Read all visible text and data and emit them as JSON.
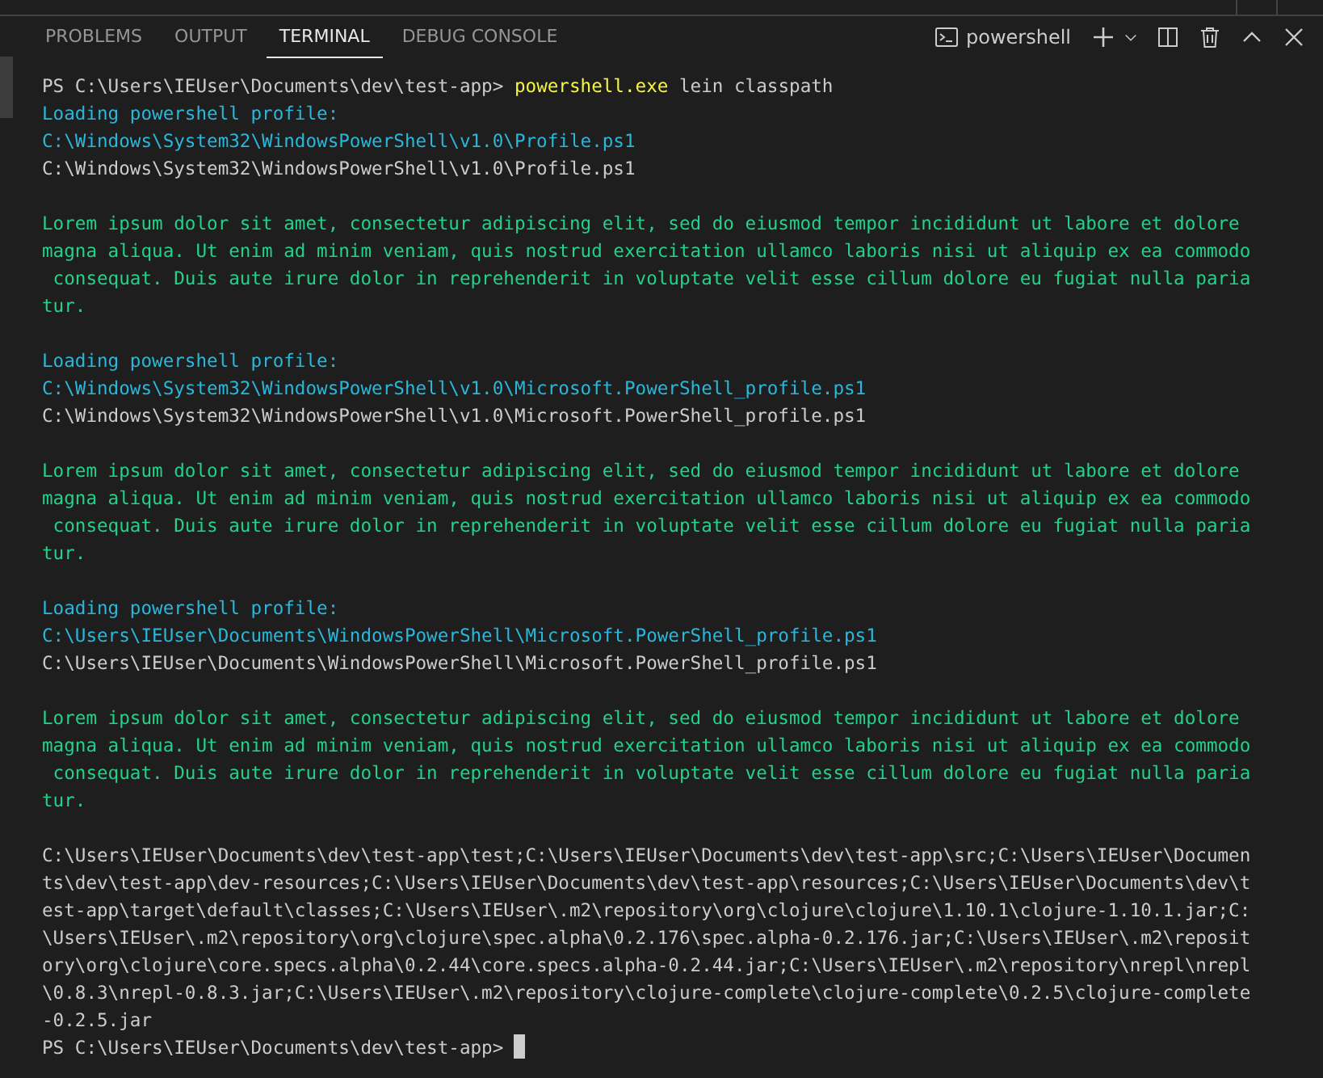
{
  "panel_tabs": [
    {
      "label": "PROBLEMS",
      "selected": false
    },
    {
      "label": "OUTPUT",
      "selected": false
    },
    {
      "label": "TERMINAL",
      "selected": true
    },
    {
      "label": "DEBUG CONSOLE",
      "selected": false
    }
  ],
  "terminal_selector": {
    "label": "powershell"
  },
  "terminal": {
    "lines": [
      {
        "kind": "prompt",
        "prompt": "PS C:\\Users\\IEUser\\Documents\\dev\\test-app>",
        "command": "powershell.exe",
        "args": "lein classpath"
      },
      {
        "kind": "info",
        "text": "Loading powershell profile:"
      },
      {
        "kind": "info",
        "text": "C:\\Windows\\System32\\WindowsPowerShell\\v1.0\\Profile.ps1"
      },
      {
        "kind": "plain",
        "text": "C:\\Windows\\System32\\WindowsPowerShell\\v1.0\\Profile.ps1"
      },
      {
        "kind": "blank"
      },
      {
        "kind": "success",
        "text": "Lorem ipsum dolor sit amet, consectetur adipiscing elit, sed do eiusmod tempor incididunt ut labore et dolore"
      },
      {
        "kind": "success",
        "text": "magna aliqua. Ut enim ad minim veniam, quis nostrud exercitation ullamco laboris nisi ut aliquip ex ea commodo"
      },
      {
        "kind": "success",
        "text": " consequat. Duis aute irure dolor in reprehenderit in voluptate velit esse cillum dolore eu fugiat nulla paria"
      },
      {
        "kind": "success",
        "text": "tur."
      },
      {
        "kind": "blank"
      },
      {
        "kind": "info",
        "text": "Loading powershell profile:"
      },
      {
        "kind": "info",
        "text": "C:\\Windows\\System32\\WindowsPowerShell\\v1.0\\Microsoft.PowerShell_profile.ps1"
      },
      {
        "kind": "plain",
        "text": "C:\\Windows\\System32\\WindowsPowerShell\\v1.0\\Microsoft.PowerShell_profile.ps1"
      },
      {
        "kind": "blank"
      },
      {
        "kind": "success",
        "text": "Lorem ipsum dolor sit amet, consectetur adipiscing elit, sed do eiusmod tempor incididunt ut labore et dolore"
      },
      {
        "kind": "success",
        "text": "magna aliqua. Ut enim ad minim veniam, quis nostrud exercitation ullamco laboris nisi ut aliquip ex ea commodo"
      },
      {
        "kind": "success",
        "text": " consequat. Duis aute irure dolor in reprehenderit in voluptate velit esse cillum dolore eu fugiat nulla paria"
      },
      {
        "kind": "success",
        "text": "tur."
      },
      {
        "kind": "blank"
      },
      {
        "kind": "info",
        "text": "Loading powershell profile:"
      },
      {
        "kind": "info",
        "text": "C:\\Users\\IEUser\\Documents\\WindowsPowerShell\\Microsoft.PowerShell_profile.ps1"
      },
      {
        "kind": "plain",
        "text": "C:\\Users\\IEUser\\Documents\\WindowsPowerShell\\Microsoft.PowerShell_profile.ps1"
      },
      {
        "kind": "blank"
      },
      {
        "kind": "success",
        "text": "Lorem ipsum dolor sit amet, consectetur adipiscing elit, sed do eiusmod tempor incididunt ut labore et dolore"
      },
      {
        "kind": "success",
        "text": "magna aliqua. Ut enim ad minim veniam, quis nostrud exercitation ullamco laboris nisi ut aliquip ex ea commodo"
      },
      {
        "kind": "success",
        "text": " consequat. Duis aute irure dolor in reprehenderit in voluptate velit esse cillum dolore eu fugiat nulla paria"
      },
      {
        "kind": "success",
        "text": "tur."
      },
      {
        "kind": "blank"
      },
      {
        "kind": "plain",
        "text": "C:\\Users\\IEUser\\Documents\\dev\\test-app\\test;C:\\Users\\IEUser\\Documents\\dev\\test-app\\src;C:\\Users\\IEUser\\Documen"
      },
      {
        "kind": "plain",
        "text": "ts\\dev\\test-app\\dev-resources;C:\\Users\\IEUser\\Documents\\dev\\test-app\\resources;C:\\Users\\IEUser\\Documents\\dev\\t"
      },
      {
        "kind": "plain",
        "text": "est-app\\target\\default\\classes;C:\\Users\\IEUser\\.m2\\repository\\org\\clojure\\clojure\\1.10.1\\clojure-1.10.1.jar;C:"
      },
      {
        "kind": "plain",
        "text": "\\Users\\IEUser\\.m2\\repository\\org\\clojure\\spec.alpha\\0.2.176\\spec.alpha-0.2.176.jar;C:\\Users\\IEUser\\.m2\\reposit"
      },
      {
        "kind": "plain",
        "text": "ory\\org\\clojure\\core.specs.alpha\\0.2.44\\core.specs.alpha-0.2.44.jar;C:\\Users\\IEUser\\.m2\\repository\\nrepl\\nrepl"
      },
      {
        "kind": "plain",
        "text": "\\0.8.3\\nrepl-0.8.3.jar;C:\\Users\\IEUser\\.m2\\repository\\clojure-complete\\clojure-complete\\0.2.5\\clojure-complete"
      },
      {
        "kind": "plain",
        "text": "-0.2.5.jar"
      },
      {
        "kind": "prompt",
        "prompt": "PS C:\\Users\\IEUser\\Documents\\dev\\test-app>",
        "cursor": true
      }
    ]
  }
}
